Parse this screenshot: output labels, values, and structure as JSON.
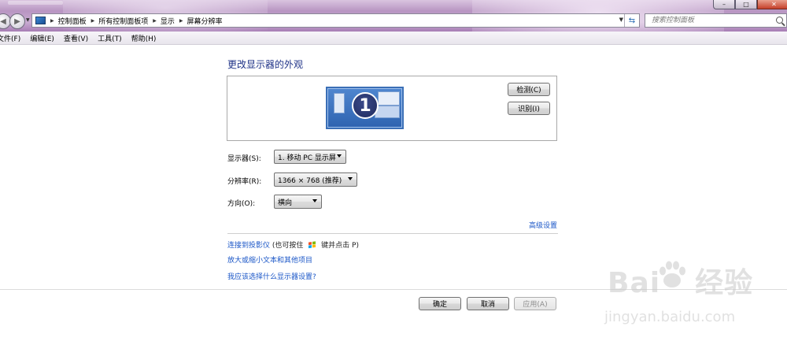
{
  "window": {
    "controls": {
      "minimize": "–",
      "maximize": "□",
      "close": "✕"
    }
  },
  "address_bar": {
    "crumbs": [
      "控制面板",
      "所有控制面板项",
      "显示",
      "屏幕分辨率"
    ]
  },
  "search": {
    "placeholder": "搜索控制面板"
  },
  "menu": [
    "文件(F)",
    "编辑(E)",
    "查看(V)",
    "工具(T)",
    "帮助(H)"
  ],
  "page": {
    "title": "更改显示器的外观",
    "monitor_number": "1",
    "detect_button": "检测(C)",
    "identify_button": "识别(I)",
    "fields": {
      "display": {
        "label": "显示器(S):",
        "value": "1. 移动 PC 显示屏"
      },
      "resolution": {
        "label": "分辨率(R):",
        "value": "1366 × 768 (推荐)"
      },
      "orientation": {
        "label": "方向(O):",
        "value": "横向"
      }
    },
    "advanced_link": "高级设置",
    "projector_link": "连接到投影仪",
    "projector_hint_prefix": "(也可按住",
    "projector_hint_suffix": "键并点击 P)",
    "text_size_link": "放大或缩小文本和其他项目",
    "help_link": "我应该选择什么显示器设置?"
  },
  "footer": {
    "ok": "确定",
    "cancel": "取消",
    "apply": "应用(A)"
  },
  "watermark": {
    "brand": "Bai",
    "brand_suffix": "经验",
    "url": "jingyan.baidu.com"
  },
  "icons": {
    "back": "back-arrow-icon",
    "forward": "forward-arrow-icon",
    "refresh": "refresh-icon",
    "search": "search-icon",
    "windows_key": "windows-logo-icon"
  }
}
